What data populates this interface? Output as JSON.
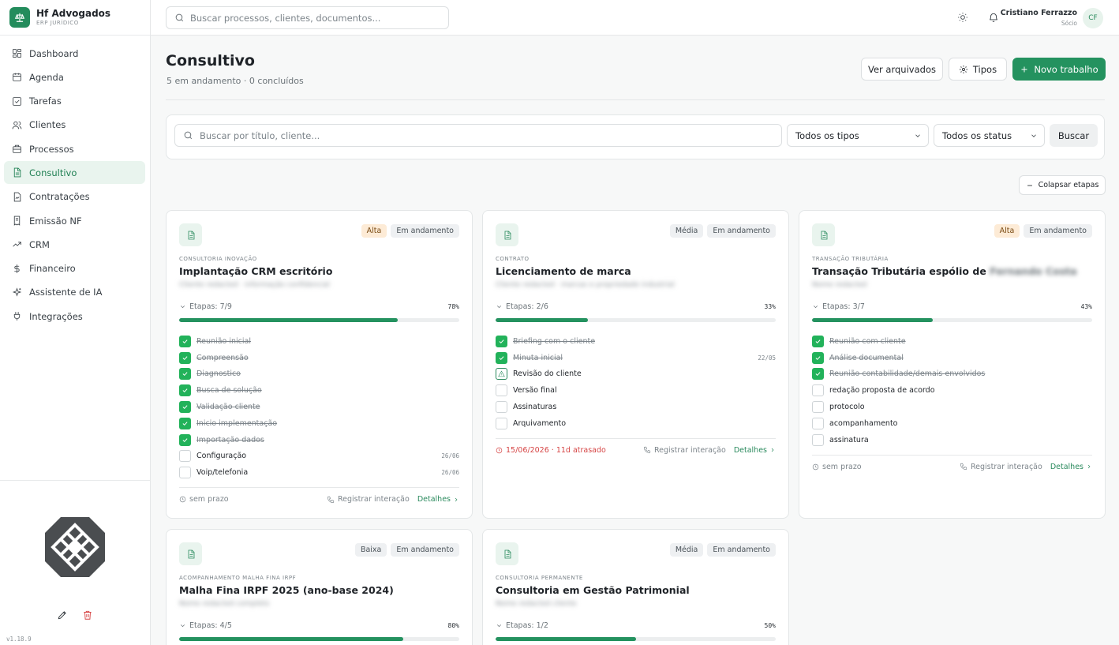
{
  "brand": {
    "name": "Hf Advogados",
    "subtitle": "ERP JURÍDICO"
  },
  "search": {
    "placeholder": "Buscar processos, clientes, documentos..."
  },
  "user": {
    "name": "Cristiano Ferrazzo",
    "role": "Sócio",
    "initials": "CF"
  },
  "nav": [
    {
      "label": "Dashboard",
      "icon": "dashboard-icon"
    },
    {
      "label": "Agenda",
      "icon": "calendar-icon"
    },
    {
      "label": "Tarefas",
      "icon": "checkbox-icon"
    },
    {
      "label": "Clientes",
      "icon": "users-icon"
    },
    {
      "label": "Processos",
      "icon": "briefcase-icon"
    },
    {
      "label": "Consultivo",
      "icon": "document-icon",
      "active": true
    },
    {
      "label": "Contratações",
      "icon": "contract-icon"
    },
    {
      "label": "Emissão NF",
      "icon": "receipt-icon"
    },
    {
      "label": "CRM",
      "icon": "trend-icon"
    },
    {
      "label": "Financeiro",
      "icon": "dollar-icon"
    },
    {
      "label": "Assistente de IA",
      "icon": "sparkles-icon"
    },
    {
      "label": "Integrações",
      "icon": "plug-icon"
    }
  ],
  "version": "v1.18.9",
  "page": {
    "title": "Consultivo",
    "subtitle": "5 em andamento · 0 concluídos"
  },
  "actions": {
    "archived": "Ver arquivados",
    "types": "Tipos",
    "new_work": "Novo trabalho"
  },
  "filters": {
    "search_placeholder": "Buscar por título, cliente...",
    "type_selected": "Todos os tipos",
    "status_selected": "Todos os status",
    "search_button": "Buscar"
  },
  "collapse_label": "Colapsar etapas",
  "footer_labels": {
    "register": "Registrar interação",
    "details": "Detalhes"
  },
  "colors": {
    "accent": "#24925f",
    "late": "#d64545",
    "high_priority_bg": "#fdebd6"
  },
  "cards": [
    {
      "priority": "Alta",
      "priority_level": "high",
      "status": "Em andamento",
      "type": "CONSULTORIA INOVAÇÃO",
      "title": "Implantação CRM escritório",
      "title_redacted": "",
      "client": "Cliente redacted · informação confidencial",
      "steps_label": "Etapas: 7/9",
      "percent_label": "78%",
      "progress": 0.78,
      "tasks": [
        {
          "label": "Reunião inicial",
          "state": "done",
          "date": ""
        },
        {
          "label": "Compreensão",
          "state": "done",
          "date": ""
        },
        {
          "label": "Diagnostico",
          "state": "done",
          "date": ""
        },
        {
          "label": "Busca de solução",
          "state": "done",
          "date": ""
        },
        {
          "label": "Validação cliente",
          "state": "done",
          "date": ""
        },
        {
          "label": "Inicio implementação",
          "state": "done",
          "date": ""
        },
        {
          "label": "Importação dados",
          "state": "done",
          "date": ""
        },
        {
          "label": "Configuração",
          "state": "todo",
          "date": "26/06"
        },
        {
          "label": "Voip/telefonia",
          "state": "todo",
          "date": "26/06"
        }
      ],
      "due": "sem prazo",
      "late": false
    },
    {
      "priority": "Média",
      "priority_level": "normal",
      "status": "Em andamento",
      "type": "CONTRATO",
      "title": "Licenciamento de marca",
      "title_redacted": "",
      "client": "Cliente redacted · marcas e propriedade industrial",
      "steps_label": "Etapas: 2/6",
      "percent_label": "33%",
      "progress": 0.33,
      "tasks": [
        {
          "label": "Briefing com o cliente",
          "state": "done",
          "date": ""
        },
        {
          "label": "Minuta inicial",
          "state": "done",
          "date": "22/05"
        },
        {
          "label": "Revisão do cliente",
          "state": "warn",
          "date": ""
        },
        {
          "label": "Versão final",
          "state": "todo",
          "date": ""
        },
        {
          "label": "Assinaturas",
          "state": "todo",
          "date": ""
        },
        {
          "label": "Arquivamento",
          "state": "todo",
          "date": ""
        }
      ],
      "due": "15/06/2026 · 11d atrasado",
      "late": true
    },
    {
      "priority": "Alta",
      "priority_level": "high",
      "status": "Em andamento",
      "type": "TRANSAÇÃO TRIBUTÁRIA",
      "title": "Transação Tributária espólio de",
      "title_redacted": "Fernando Costa",
      "client": "Nome redacted",
      "steps_label": "Etapas: 3/7",
      "percent_label": "43%",
      "progress": 0.43,
      "tasks": [
        {
          "label": "Reunião com cliente",
          "state": "done",
          "date": ""
        },
        {
          "label": "Análise documental",
          "state": "done",
          "date": ""
        },
        {
          "label": "Reunião contabilidade/demais envolvidos",
          "state": "done",
          "date": ""
        },
        {
          "label": "redação proposta de acordo",
          "state": "todo",
          "date": ""
        },
        {
          "label": "protocolo",
          "state": "todo",
          "date": ""
        },
        {
          "label": "acompanhamento",
          "state": "todo",
          "date": ""
        },
        {
          "label": "assinatura",
          "state": "todo",
          "date": ""
        }
      ],
      "due": "sem prazo",
      "late": false
    },
    {
      "priority": "Baixa",
      "priority_level": "normal",
      "status": "Em andamento",
      "type": "ACOMPANHAMENTO MALHA FINA IRPF",
      "title": "Malha Fina IRPF 2025 (ano-base 2024)",
      "title_redacted": "",
      "client": "Nome redacted completo",
      "steps_label": "Etapas: 4/5",
      "percent_label": "80%",
      "progress": 0.8,
      "tasks": [],
      "due": "",
      "late": false
    },
    {
      "priority": "Média",
      "priority_level": "normal",
      "status": "Em andamento",
      "type": "CONSULTORIA PERMANENTE",
      "title": "Consultoria em Gestão Patrimonial",
      "title_redacted": "",
      "client": "Nome redacted cliente",
      "steps_label": "Etapas: 1/2",
      "percent_label": "50%",
      "progress": 0.5,
      "tasks": [],
      "due": "",
      "late": false
    }
  ]
}
